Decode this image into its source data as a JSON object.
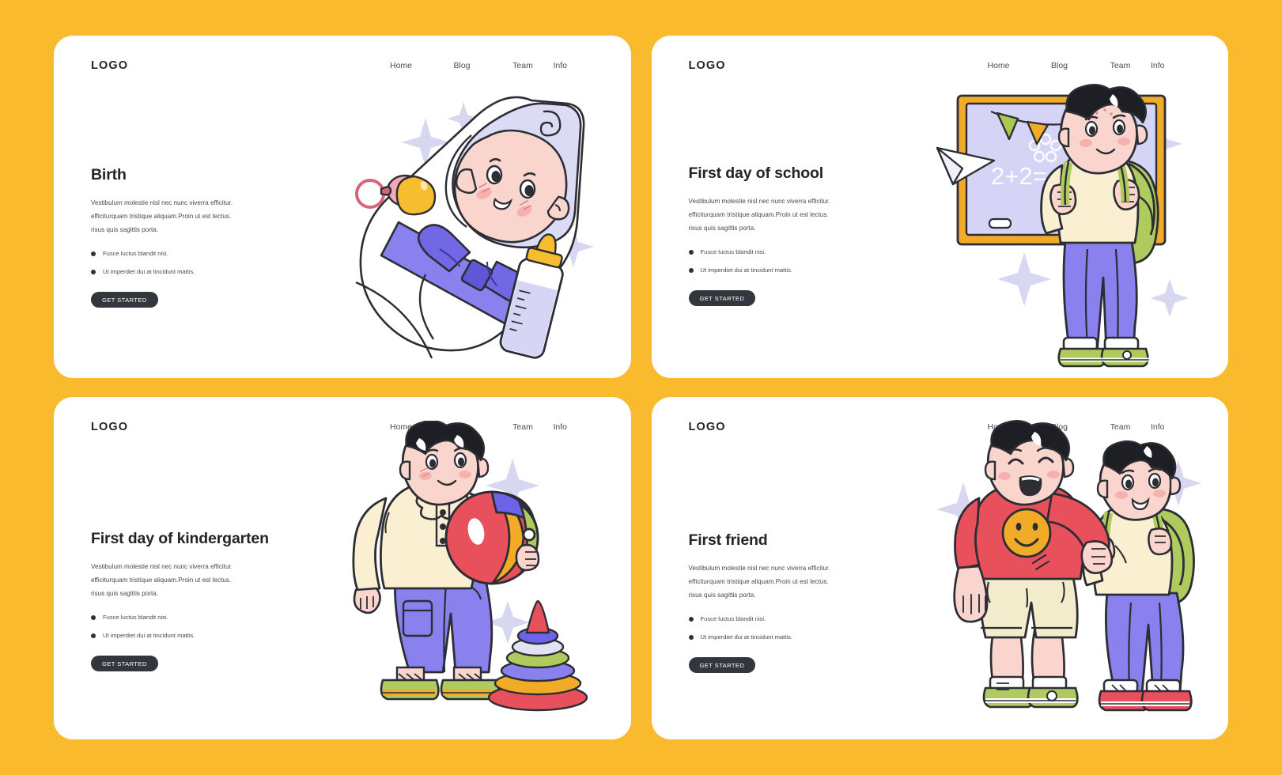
{
  "page": {
    "background_color": "#F9BB2D",
    "card_background": "#FFFFFF",
    "accent_dark": "#33363C",
    "sparkle_color": "#D8D7F2"
  },
  "shared": {
    "logo": "LOGO",
    "nav": [
      "Home",
      "Blog",
      "Team",
      "Info"
    ],
    "lead": "Vestibulum molestie nisl nec nunc viverra efficitur. efficiturquam tristique aliquam.Proin ut est lectus. risus quis sagittis porta.",
    "bullets": [
      "Fusce luctus blandit nisi.",
      "Ut imperdiet dui at tincidunt mattis."
    ],
    "cta": "GET STARTED"
  },
  "cards": [
    {
      "id": "birth",
      "title": "Birth",
      "illustration": "swaddled-baby-with-pacifier-and-bottle"
    },
    {
      "id": "first-day-of-school",
      "title": "First day of school",
      "illustration": "schoolboy-with-backpack-at-chalkboard",
      "chalkboard_text": "2+2=4"
    },
    {
      "id": "first-day-of-kindergarten",
      "title": "First day of kindergarten",
      "illustration": "child-with-beach-ball-and-stacking-rings"
    },
    {
      "id": "first-friend",
      "title": "First friend",
      "illustration": "two-boys-arm-in-arm"
    }
  ]
}
